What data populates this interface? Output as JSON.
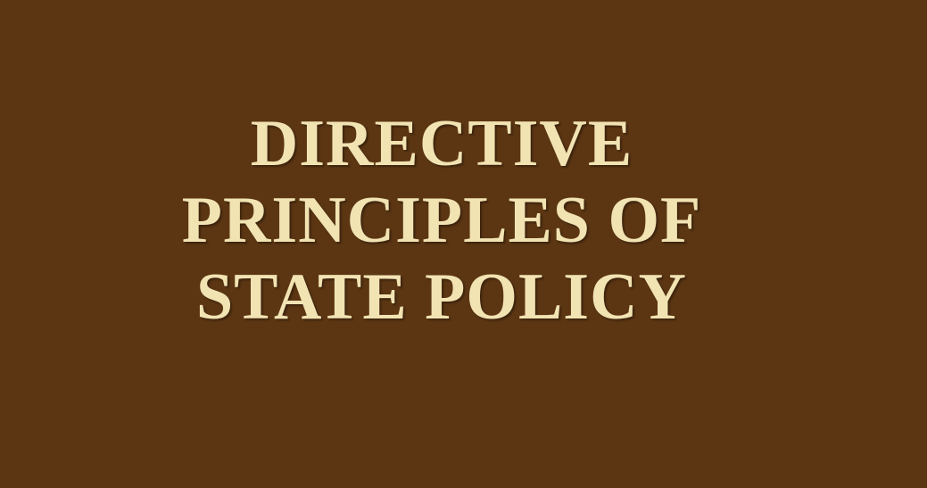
{
  "title": {
    "lines": [
      "DIRECTIVE",
      "PRINCIPLES OF",
      "STATE POLICY"
    ]
  },
  "colors": {
    "background": "#5c3613",
    "text": "#f2e3b3"
  }
}
